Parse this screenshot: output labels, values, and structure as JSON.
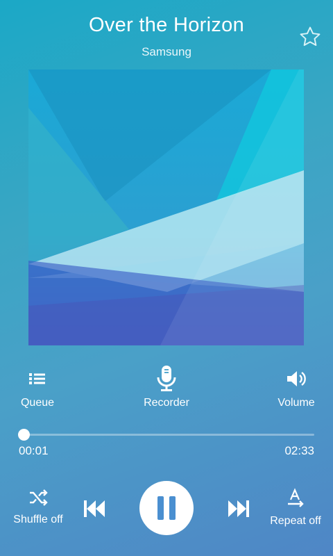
{
  "track": {
    "title": "Over the Horizon",
    "artist": "Samsung"
  },
  "icons": {
    "favorite": "star-outline-icon",
    "queue": "list-icon",
    "recorder": "microphone-icon",
    "volume": "speaker-icon",
    "shuffle": "shuffle-icon",
    "previous": "skip-previous-icon",
    "pause": "pause-icon",
    "next": "skip-next-icon",
    "repeat": "repeat-icon"
  },
  "controls": {
    "queue_label": "Queue",
    "recorder_label": "Recorder",
    "volume_label": "Volume"
  },
  "playback": {
    "elapsed": "00:01",
    "duration": "02:33",
    "progress_fraction": 0.007,
    "shuffle_label": "Shuffle off",
    "repeat_label": "Repeat off"
  },
  "colors": {
    "pause_icon": "#4a8fd0",
    "foreground": "#ffffff"
  }
}
